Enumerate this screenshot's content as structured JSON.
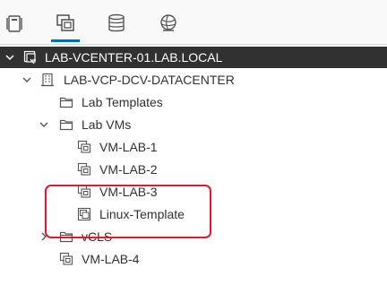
{
  "tabs": [
    {
      "icon": "hosts-clusters-icon"
    },
    {
      "icon": "vms-templates-icon",
      "active": true
    },
    {
      "icon": "storage-icon"
    },
    {
      "icon": "networking-icon"
    }
  ],
  "tree": {
    "vcenter": {
      "label": "LAB-VCENTER-01.LAB.LOCAL",
      "icon": "vcenter-icon",
      "expanded": true,
      "selected": true
    },
    "datacenter": {
      "label": "LAB-VCP-DCV-DATACENTER",
      "icon": "datacenter-icon",
      "expanded": true
    },
    "lab_templates": {
      "label": "Lab Templates",
      "icon": "folder-icon"
    },
    "lab_vms": {
      "label": "Lab VMs",
      "icon": "folder-icon",
      "expanded": true
    },
    "vm1": {
      "label": "VM-LAB-1",
      "icon": "vm-icon"
    },
    "vm2": {
      "label": "VM-LAB-2",
      "icon": "vm-icon"
    },
    "vm3": {
      "label": "VM-LAB-3",
      "icon": "vm-icon"
    },
    "linux_template": {
      "label": "Linux-Template",
      "icon": "template-icon"
    },
    "vcls": {
      "label": "vCLS",
      "icon": "folder-icon",
      "expanded": false
    },
    "vm4": {
      "label": "VM-LAB-4",
      "icon": "vm-icon"
    }
  },
  "colors": {
    "selected_bg": "#313131",
    "accent": "#0072a3",
    "highlight": "#e0192d"
  }
}
